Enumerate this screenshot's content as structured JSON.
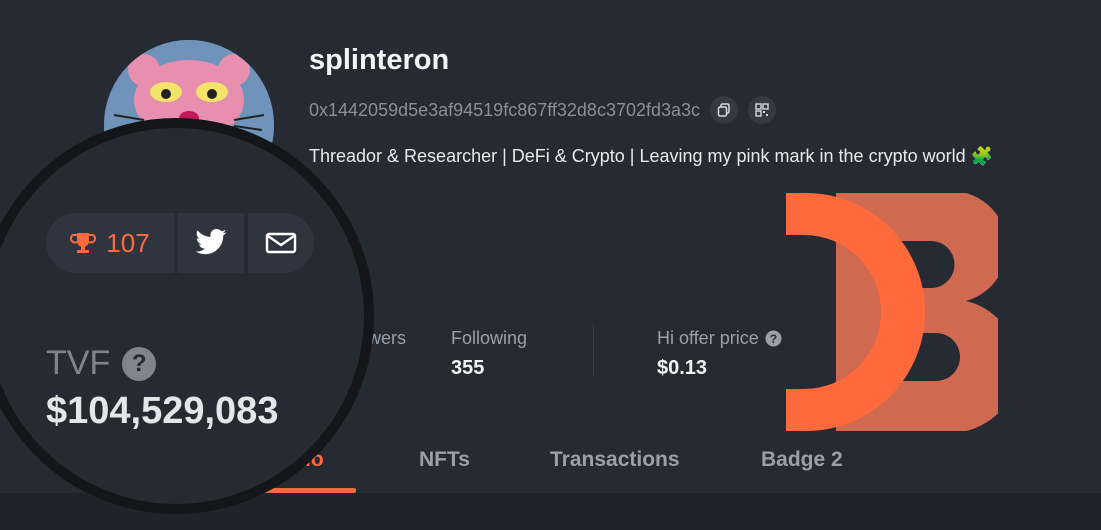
{
  "profile": {
    "username": "splinteron",
    "address": "0x1442059d5e3af94519fc867ff32d8c3702fd3a3c",
    "bio": "Threador & Researcher | DeFi & Crypto | Leaving my pink mark in the crypto world 🧩"
  },
  "stats": [
    {
      "label": "Followers",
      "value": ""
    },
    {
      "label": "Following",
      "value": "355"
    },
    {
      "label": "Hi offer price",
      "value": "$0.13"
    }
  ],
  "tabs": [
    {
      "label": "Portfolio",
      "active": true
    },
    {
      "label": "NFTs"
    },
    {
      "label": "Transactions"
    },
    {
      "label": "Badge 2"
    }
  ],
  "magnifier": {
    "badge_count": "107",
    "tvf_label": "TVF",
    "tvf_help": "?",
    "tvf_value": "$104,529,083"
  },
  "colors": {
    "background": "#262a33",
    "accent": "#ff6a3d",
    "logo_primary": "#ff6a3d",
    "logo_secondary": "#cf6a50"
  },
  "icons": {
    "copy": "copy-icon",
    "qr": "qr-code-icon",
    "trophy": "trophy-icon",
    "twitter": "twitter-icon",
    "email": "email-icon",
    "help": "help-icon"
  }
}
